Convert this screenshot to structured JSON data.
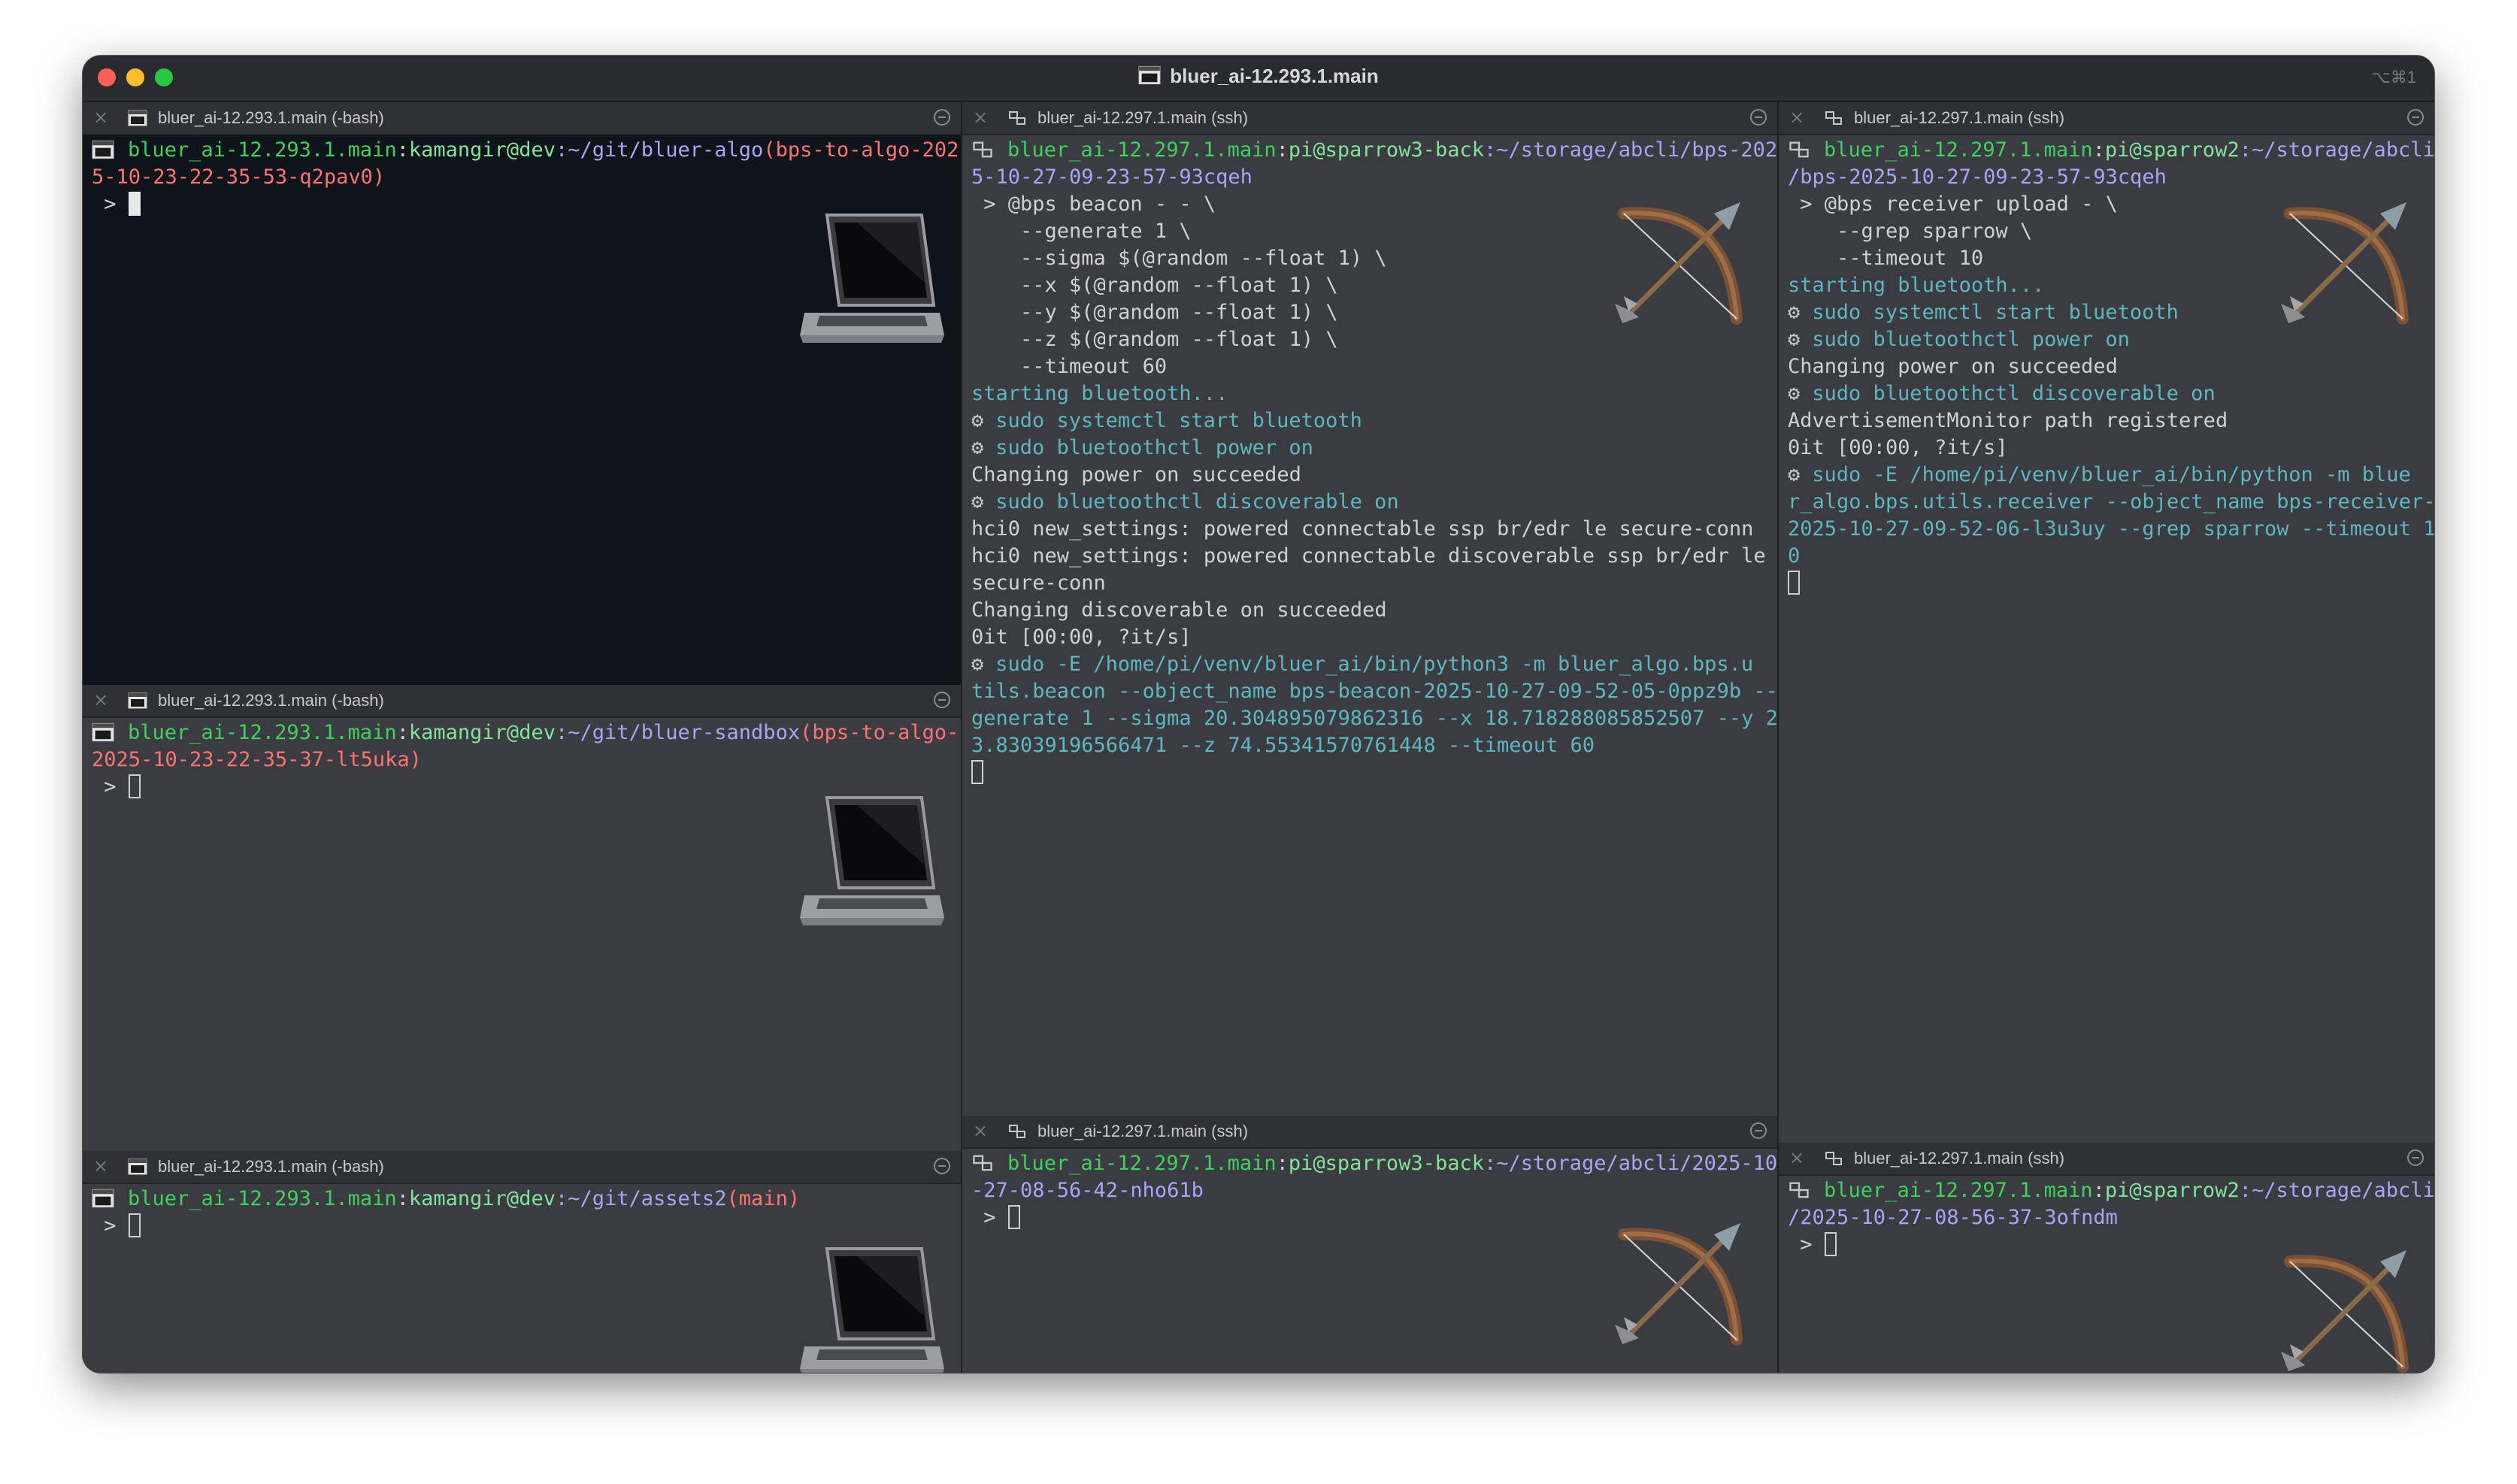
{
  "window": {
    "title": "bluer_ai-12.293.1.main",
    "shortcut": "⌥⌘1"
  },
  "panes": {
    "p1": {
      "tab_title": "bluer_ai-12.293.1.main (-bash)",
      "host": "bluer_ai-12.293.1.main",
      "sep": ":",
      "user": "kamangir@dev",
      "path": ":~/git/bluer-algo",
      "branch1": "(bps-to-algo-202",
      "branch2": "5-10-23-22-35-53-q2pav0)",
      "prompt": " > "
    },
    "p2": {
      "tab_title": "bluer_ai-12.293.1.main (-bash)",
      "host": "bluer_ai-12.293.1.main",
      "sep": ":",
      "user": "kamangir@dev",
      "path": ":~/git/bluer-sandbox",
      "branch1": "(bps-to-algo-",
      "branch2": "2025-10-23-22-35-37-lt5uka)",
      "prompt": " > "
    },
    "p3": {
      "tab_title": "bluer_ai-12.293.1.main (-bash)",
      "host": "bluer_ai-12.293.1.main",
      "sep": ":",
      "user": "kamangir@dev",
      "path": ":~/git/assets2",
      "branch1": "(main)",
      "prompt": " > "
    },
    "p4": {
      "tab_title": "bluer_ai-12.297.1.main (ssh)",
      "host": "bluer_ai-12.297.1.main",
      "sep": ":",
      "user": "pi@sparrow3-back",
      "path1": ":~/storage/abcli/bps-202",
      "path2": "5-10-27-09-23-57-93cqeh",
      "cmd": [
        " > @bps beacon - - \\",
        "    --generate 1 \\",
        "    --sigma $(@random --float 1) \\",
        "    --x $(@random --float 1) \\",
        "    --y $(@random --float 1) \\",
        "    --z $(@random --float 1) \\",
        "    --timeout 60"
      ],
      "starting": "starting bluetooth...",
      "g1": "sudo systemctl start bluetooth",
      "g2": "sudo bluetoothctl power on",
      "power_ok": "Changing power on succeeded",
      "g3": "sudo bluetoothctl discoverable on",
      "hci1": "hci0 new_settings: powered connectable ssp br/edr le secure-conn",
      "hci2a": "hci0 new_settings: powered connectable discoverable ssp br/edr le",
      "hci2b": "secure-conn",
      "disc_ok": "Changing discoverable on succeeded",
      "progress": "0it [00:00, ?it/s]",
      "py1": "sudo -E /home/pi/venv/bluer_ai/bin/python3 -m bluer_algo.bps.u",
      "py2": "tils.beacon --object_name bps-beacon-2025-10-27-09-52-05-0ppz9b --",
      "py3": "generate 1 --sigma 20.304895079862316 --x 18.718288085852507 --y 2",
      "py4": "3.83039196566471 --z 74.55341570761448 --timeout 60"
    },
    "p5": {
      "tab_title": "bluer_ai-12.297.1.main (ssh)",
      "host": "bluer_ai-12.297.1.main",
      "sep": ":",
      "user": "pi@sparrow3-back",
      "path1": ":~/storage/abcli/2025-10",
      "path2": "-27-08-56-42-nho61b",
      "prompt": " > "
    },
    "p6": {
      "tab_title": "bluer_ai-12.297.1.main (ssh)",
      "host": "bluer_ai-12.297.1.main",
      "sep": ":",
      "user": "pi@sparrow2",
      "path1": ":~/storage/abcli",
      "path2": "/bps-2025-10-27-09-23-57-93cqeh",
      "cmd": [
        " > @bps receiver upload - \\",
        "    --grep sparrow \\",
        "    --timeout 10"
      ],
      "starting": "starting bluetooth...",
      "g1": "sudo systemctl start bluetooth",
      "g2": "sudo bluetoothctl power on",
      "power_ok": "Changing power on succeeded",
      "g3": "sudo bluetoothctl discoverable on",
      "adv": "AdvertisementMonitor path registered",
      "progress": "0it [00:00, ?it/s]",
      "py1": "sudo -E /home/pi/venv/bluer_ai/bin/python -m blue",
      "py2": "r_algo.bps.utils.receiver --object_name bps-receiver-",
      "py3": "2025-10-27-09-52-06-l3u3uy --grep sparrow --timeout 1",
      "py4": "0"
    },
    "p7": {
      "tab_title": "bluer_ai-12.297.1.main (ssh)",
      "host": "bluer_ai-12.297.1.main",
      "sep": ":",
      "user": "pi@sparrow2",
      "path1": ":~/storage/abcli",
      "path2": "/2025-10-27-08-56-37-3ofndm",
      "prompt": " > "
    }
  },
  "icons": {
    "laptop": "laptop-emoji",
    "bow": "bow-and-arrow-emoji",
    "gear": "⚙"
  }
}
